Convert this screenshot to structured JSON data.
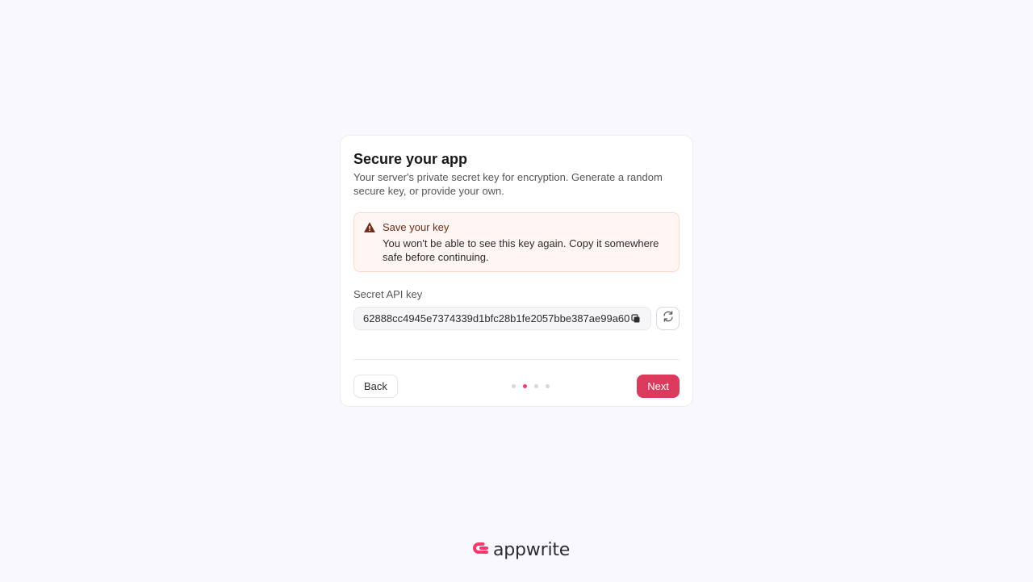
{
  "card": {
    "title": "Secure your app",
    "subtitle": "Your server's private secret key for encryption. Generate a random secure key, or provide your own."
  },
  "alert": {
    "icon": "warning-icon",
    "title": "Save your key",
    "text": "You won't be able to see this key again. Copy it somewhere safe before continuing."
  },
  "secret_key": {
    "label": "Secret API key",
    "value": "62888cc4945e7374339d1bfc28b1fe2057bbe387ae99a60b",
    "copy_icon": "copy-icon",
    "regenerate_icon": "refresh-icon"
  },
  "footer": {
    "back_label": "Back",
    "next_label": "Next",
    "steps_total": 4,
    "steps_active": 2
  },
  "brand": {
    "name": "appwrite",
    "color": "#fd366e"
  },
  "colors": {
    "accent": "#dc3a5d",
    "background": "#f9f8fc"
  }
}
